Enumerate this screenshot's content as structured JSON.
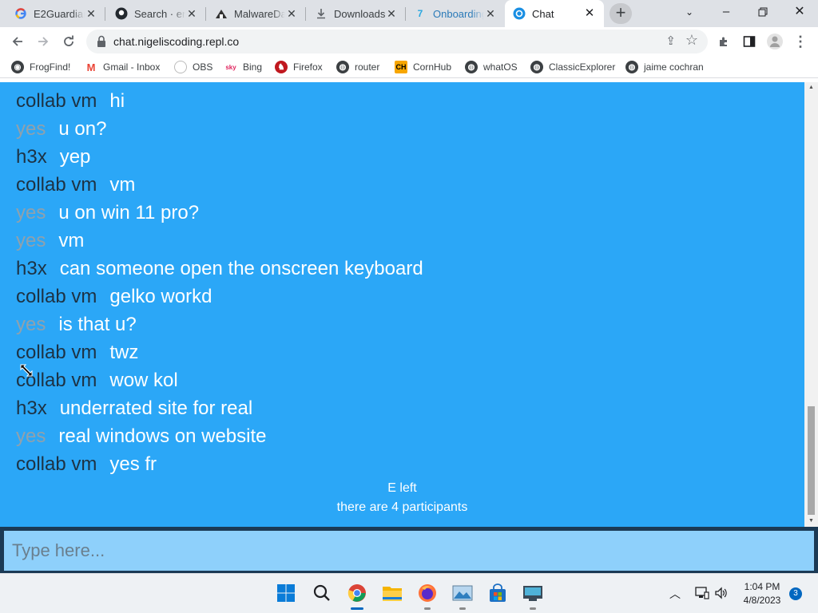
{
  "browser": {
    "tabs": [
      {
        "title": "E2Guardian",
        "icon": "google-icon"
      },
      {
        "title": "Search · enc",
        "icon": "github-icon"
      },
      {
        "title": "MalwareDa",
        "icon": "malware-icon"
      },
      {
        "title": "Downloads",
        "icon": "download-icon"
      },
      {
        "title": "Onboarding",
        "icon": "onboarding-icon"
      },
      {
        "title": "Chat",
        "icon": "chat-icon"
      }
    ],
    "active_tab": 5,
    "url": "chat.nigeliscoding.repl.co",
    "bookmarks": [
      {
        "label": "FrogFind!",
        "icon": "frogfind-icon"
      },
      {
        "label": "Gmail - Inbox",
        "icon": "gmail-icon"
      },
      {
        "label": "OBS",
        "icon": "obs-icon"
      },
      {
        "label": "Bing",
        "icon": "bing-icon"
      },
      {
        "label": "Firefox",
        "icon": "firefox-icon"
      },
      {
        "label": "router",
        "icon": "globe-icon"
      },
      {
        "label": "CornHub",
        "icon": "cornhub-icon"
      },
      {
        "label": "whatOS",
        "icon": "globe-icon"
      },
      {
        "label": "ClassicExplorer",
        "icon": "globe-icon"
      },
      {
        "label": "jaime cochran",
        "icon": "globe-icon"
      }
    ]
  },
  "chat": {
    "messages": [
      {
        "user": "collab vm",
        "text": "hi",
        "tone": "dark"
      },
      {
        "user": "yes",
        "text": "u on?",
        "tone": "gray"
      },
      {
        "user": "h3x",
        "text": "yep",
        "tone": "dark"
      },
      {
        "user": "collab vm",
        "text": "vm",
        "tone": "dark"
      },
      {
        "user": "yes",
        "text": "u on win 11 pro?",
        "tone": "gray"
      },
      {
        "user": "yes",
        "text": "vm",
        "tone": "gray"
      },
      {
        "user": "h3x",
        "text": "can someone open the onscreen keyboard",
        "tone": "dark"
      },
      {
        "user": "collab vm",
        "text": "gelko workd",
        "tone": "dark"
      },
      {
        "user": "yes",
        "text": "is that u?",
        "tone": "gray"
      },
      {
        "user": "collab vm",
        "text": "twz",
        "tone": "dark"
      },
      {
        "user": "collab vm",
        "text": "wow kol",
        "tone": "dark"
      },
      {
        "user": "h3x",
        "text": "underrated site for real",
        "tone": "dark"
      },
      {
        "user": "yes",
        "text": "real windows on website",
        "tone": "gray"
      },
      {
        "user": "collab vm",
        "text": "yes fr",
        "tone": "dark"
      }
    ],
    "system": [
      "E left",
      "there are 4 participants"
    ],
    "input_placeholder": "Type here...",
    "colors": {
      "background": "#2ba7f7",
      "input_bg": "#8ed0fb",
      "input_frame": "#1b3a55",
      "dark_user": "#1d3244",
      "gray_user": "#8fa1ad"
    }
  },
  "taskbar": {
    "apps": [
      "start-icon",
      "search-icon",
      "chrome-icon",
      "file-explorer-icon",
      "firefox-icon",
      "photos-icon",
      "store-icon",
      "remote-desktop-icon"
    ],
    "time": "1:04 PM",
    "date": "4/8/2023",
    "notifications": "3"
  }
}
